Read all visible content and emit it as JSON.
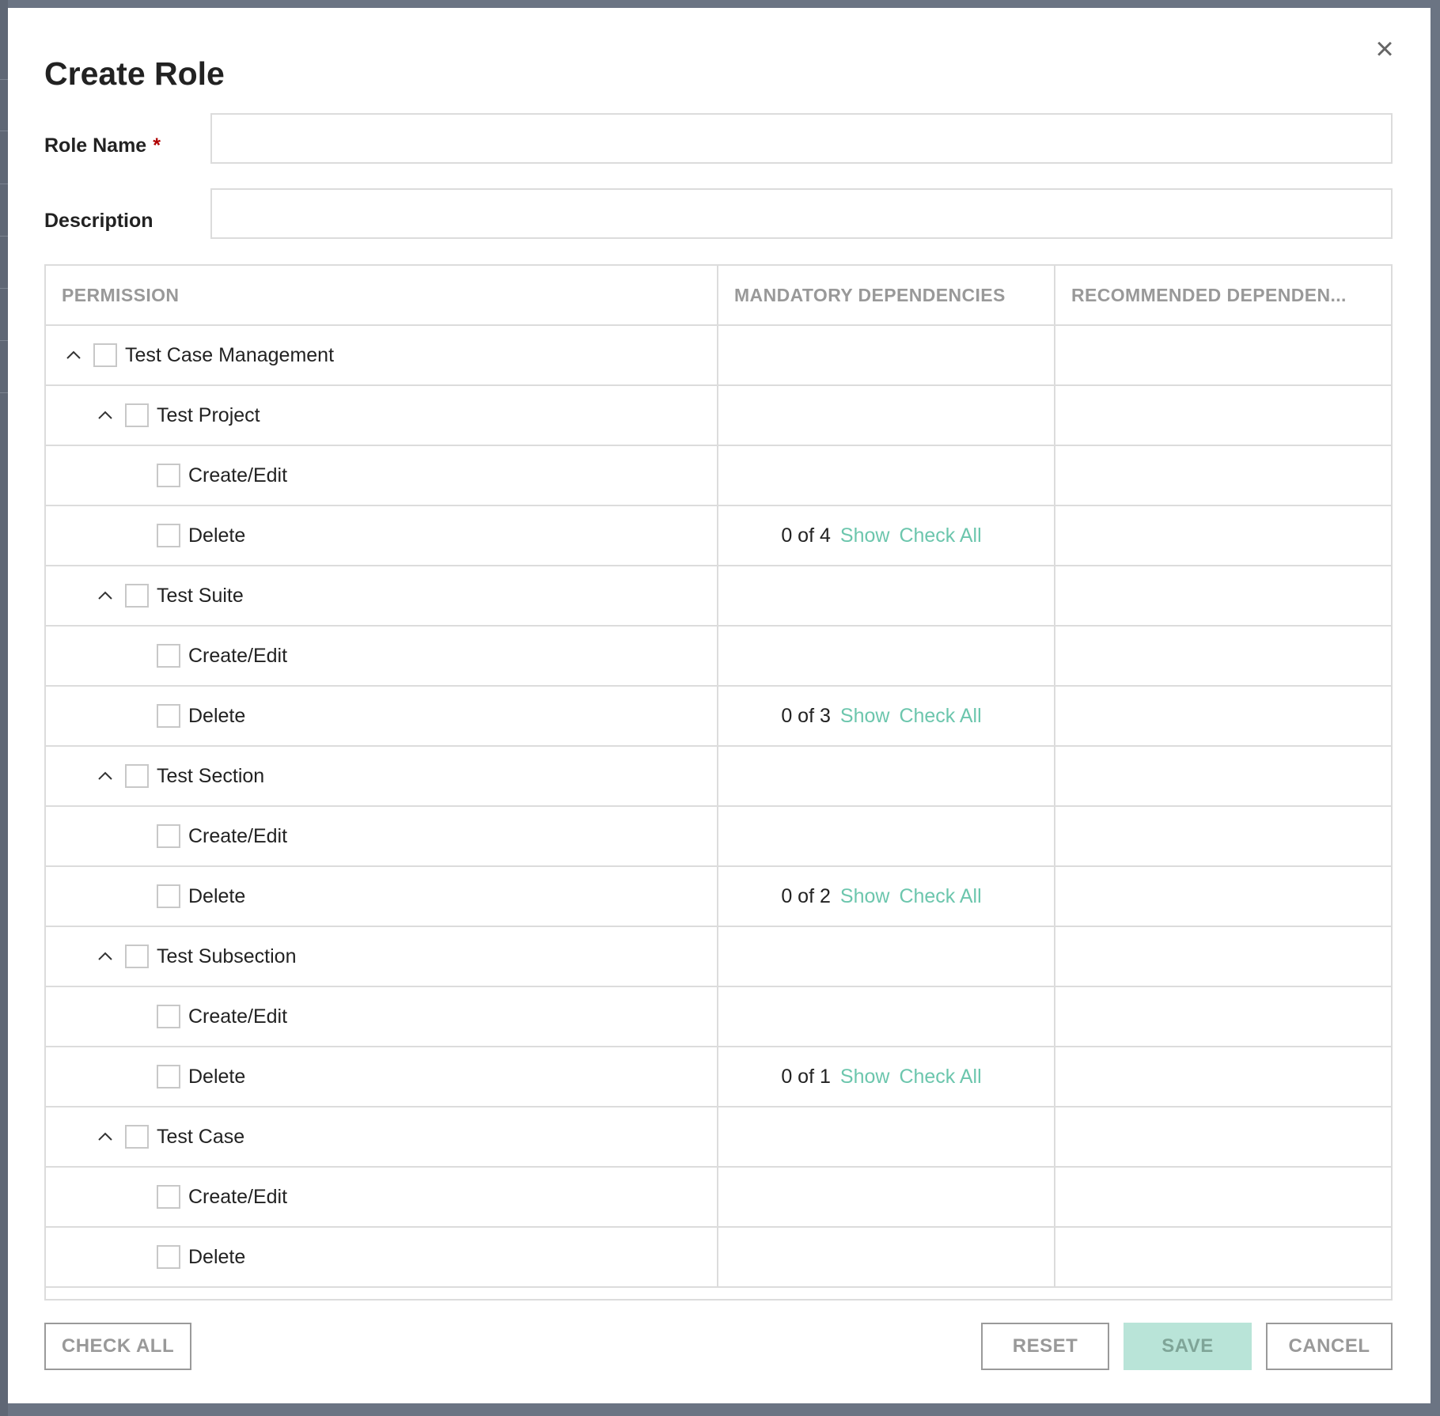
{
  "dialog": {
    "title": "Create Role",
    "close_glyph": "×"
  },
  "form": {
    "role_name_label": "Role Name",
    "required_marker": "*",
    "role_name_value": "",
    "description_label": "Description",
    "description_value": ""
  },
  "table": {
    "columns": [
      "PERMISSION",
      "MANDATORY DEPENDENCIES",
      "RECOMMENDED DEPENDEN..."
    ],
    "rows": [
      {
        "level": 0,
        "label": "Test Case Management",
        "expandable": true,
        "checked": false
      },
      {
        "level": 1,
        "label": "Test Project",
        "expandable": true,
        "checked": false
      },
      {
        "level": 2,
        "label": "Create/Edit",
        "expandable": false,
        "checked": false
      },
      {
        "level": 2,
        "label": "Delete",
        "expandable": false,
        "checked": false,
        "mandatory": {
          "count": "0 of 4",
          "show": "Show",
          "check_all": "Check All"
        }
      },
      {
        "level": 1,
        "label": "Test Suite",
        "expandable": true,
        "checked": false
      },
      {
        "level": 2,
        "label": "Create/Edit",
        "expandable": false,
        "checked": false
      },
      {
        "level": 2,
        "label": "Delete",
        "expandable": false,
        "checked": false,
        "mandatory": {
          "count": "0 of 3",
          "show": "Show",
          "check_all": "Check All"
        }
      },
      {
        "level": 1,
        "label": "Test Section",
        "expandable": true,
        "checked": false
      },
      {
        "level": 2,
        "label": "Create/Edit",
        "expandable": false,
        "checked": false
      },
      {
        "level": 2,
        "label": "Delete",
        "expandable": false,
        "checked": false,
        "mandatory": {
          "count": "0 of 2",
          "show": "Show",
          "check_all": "Check All"
        }
      },
      {
        "level": 1,
        "label": "Test Subsection",
        "expandable": true,
        "checked": false
      },
      {
        "level": 2,
        "label": "Create/Edit",
        "expandable": false,
        "checked": false
      },
      {
        "level": 2,
        "label": "Delete",
        "expandable": false,
        "checked": false,
        "mandatory": {
          "count": "0 of 1",
          "show": "Show",
          "check_all": "Check All"
        }
      },
      {
        "level": 1,
        "label": "Test Case",
        "expandable": true,
        "checked": false
      },
      {
        "level": 2,
        "label": "Create/Edit",
        "expandable": false,
        "checked": false
      },
      {
        "level": 2,
        "label": "Delete",
        "expandable": false,
        "checked": false
      }
    ]
  },
  "footer": {
    "check_all": "CHECK ALL",
    "reset": "RESET",
    "save": "SAVE",
    "cancel": "CANCEL"
  },
  "icons": {
    "expand": "chevron-up-icon",
    "close": "close-icon"
  },
  "colors": {
    "accent": "#6cc6ad",
    "save_disabled_bg": "#b9e4d8",
    "required": "#b00000",
    "overlay": "#6b7483"
  }
}
